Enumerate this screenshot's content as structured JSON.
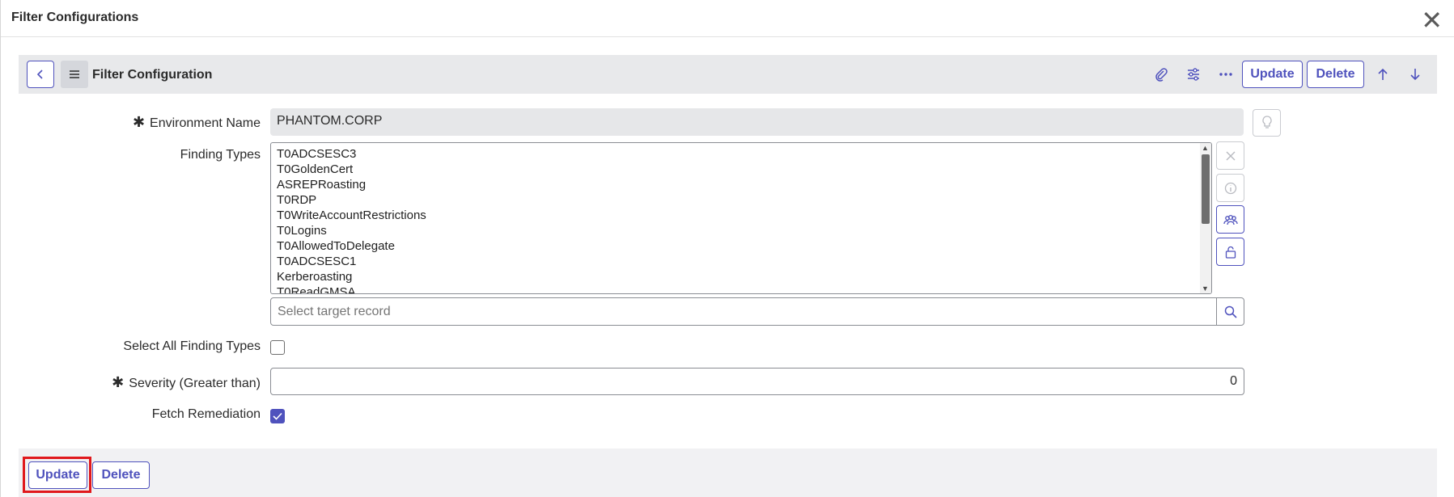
{
  "dialog": {
    "title": "Filter Configurations",
    "close_icon": "close-icon"
  },
  "header": {
    "title": "Filter Configuration",
    "update_label": "Update",
    "delete_label": "Delete",
    "icons": [
      "back-icon",
      "menu-icon",
      "attachment-icon",
      "settings-icon",
      "more-icon",
      "arrow-up-icon",
      "arrow-down-icon"
    ]
  },
  "form": {
    "environment_name": {
      "label": "Environment Name",
      "value": "PHANTOM.CORP"
    },
    "finding_types": {
      "label": "Finding Types",
      "items": [
        "T0ADCSESC3",
        "T0GoldenCert",
        "ASREPRoasting",
        "T0RDP",
        "T0WriteAccountRestrictions",
        "T0Logins",
        "T0AllowedToDelegate",
        "T0ADCSESC1",
        "Kerberoasting",
        "T0ReadGMSA"
      ],
      "reference_placeholder": "Select target record"
    },
    "select_all": {
      "label": "Select All Finding Types",
      "checked": false
    },
    "severity": {
      "label": "Severity (Greater than)",
      "value": "0"
    },
    "fetch_remediation": {
      "label": "Fetch Remediation",
      "checked": true
    }
  },
  "footer": {
    "update_label": "Update",
    "delete_label": "Delete"
  },
  "colors": {
    "accent": "#4f52bd",
    "highlight": "#e0181c"
  }
}
